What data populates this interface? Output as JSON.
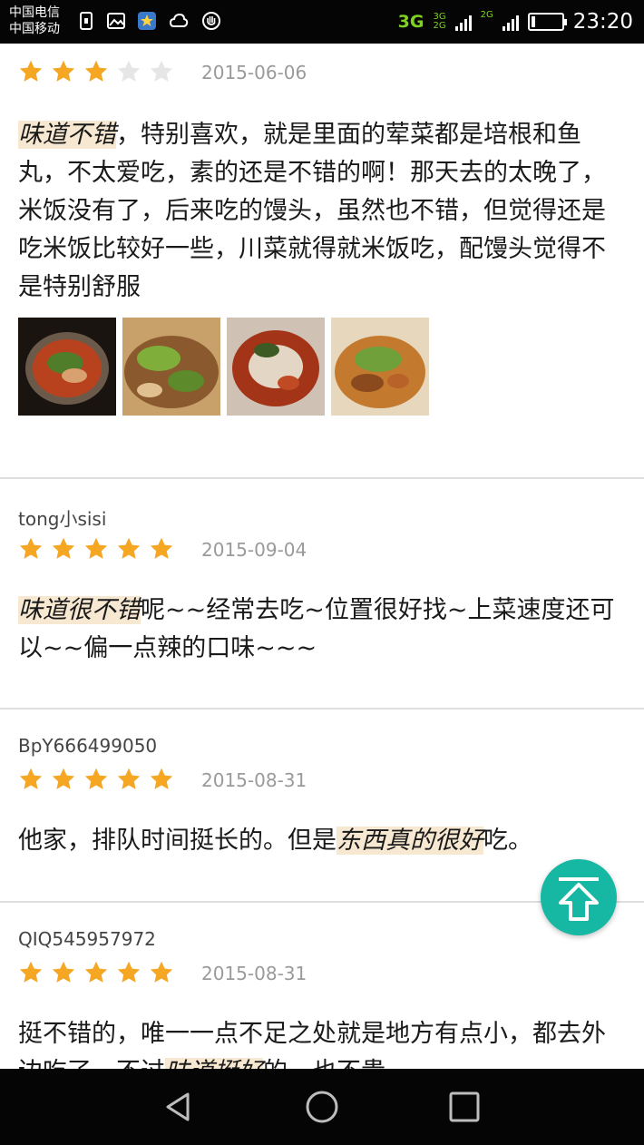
{
  "status_bar": {
    "carrier_1": "中国电信",
    "carrier_2": "中国移动",
    "network_main": "3G",
    "network_small_top": "3G",
    "network_small_bottom": "2G",
    "network_2": "2G",
    "time": "23:20",
    "accent_color": "#7ed321"
  },
  "reviews": [
    {
      "username": "",
      "rating": 3,
      "max_rating": 5,
      "date": "2015-06-06",
      "highlight": "味道不错",
      "text": "，特别喜欢，就是里面的荤菜都是培根和鱼丸，不太爱吃，素的还是不错的啊！那天去的太晚了，米饭没有了，后来吃的馒头，虽然也不错，但觉得还是吃米饭比较好一些，川菜就得就米饭吃，配馒头觉得不是特别舒服",
      "photo_count": 4
    },
    {
      "username": "tong小sisi",
      "rating": 5,
      "max_rating": 5,
      "date": "2015-09-04",
      "highlight": "味道很不错",
      "text": "呢~~经常去吃~位置很好找~上菜速度还可以~~偏一点辣的口味~~~"
    },
    {
      "username": "BpY666499050",
      "rating": 5,
      "max_rating": 5,
      "date": "2015-08-31",
      "text_before": "他家，排队时间挺长的。但是",
      "highlight": "东西真的很好",
      "text_after": "吃。"
    },
    {
      "username": "QIQ545957972",
      "rating": 5,
      "max_rating": 5,
      "date": "2015-08-31",
      "text_before": "挺不错的，唯一一点不足之处就是地方有点小，都去外边吃了，不过",
      "highlight": "味道挺好",
      "text_after": "的，也不贵"
    }
  ],
  "colors": {
    "star_filled": "#f5a623",
    "star_empty": "#e6e6e6",
    "highlight_bg": "#f7e8d2",
    "back_to_top": "#17b8a3"
  },
  "icons": {
    "back_to_top": "arrow-up-icon",
    "nav_back": "back-triangle-icon",
    "nav_home": "home-circle-icon",
    "nav_recent": "recent-square-icon"
  }
}
